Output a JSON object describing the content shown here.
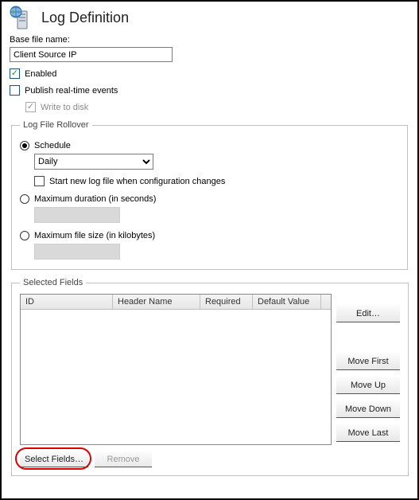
{
  "header": {
    "title": "Log Definition"
  },
  "base_file": {
    "label": "Base file name:",
    "value": "Client Source IP"
  },
  "enabled": {
    "label": "Enabled",
    "checked": true
  },
  "publish": {
    "label": "Publish real-time events",
    "checked": false
  },
  "write_disk": {
    "label": "Write to disk",
    "checked": true,
    "disabled": true
  },
  "rollover": {
    "legend": "Log File Rollover",
    "schedule": {
      "label": "Schedule",
      "selected": true,
      "option": "Daily"
    },
    "start_new": {
      "label": "Start new log file when configuration changes",
      "checked": false
    },
    "max_duration": {
      "label": "Maximum duration (in seconds)",
      "selected": false,
      "value": ""
    },
    "max_size": {
      "label": "Maximum file size (in kilobytes)",
      "selected": false,
      "value": ""
    }
  },
  "selected_fields": {
    "legend": "Selected Fields",
    "columns": [
      "ID",
      "Header Name",
      "Required",
      "Default Value",
      ""
    ],
    "buttons": {
      "edit": "Edit…",
      "move_first": "Move First",
      "move_up": "Move Up",
      "move_down": "Move Down",
      "move_last": "Move Last",
      "select_fields": "Select Fields…",
      "remove": "Remove"
    }
  }
}
